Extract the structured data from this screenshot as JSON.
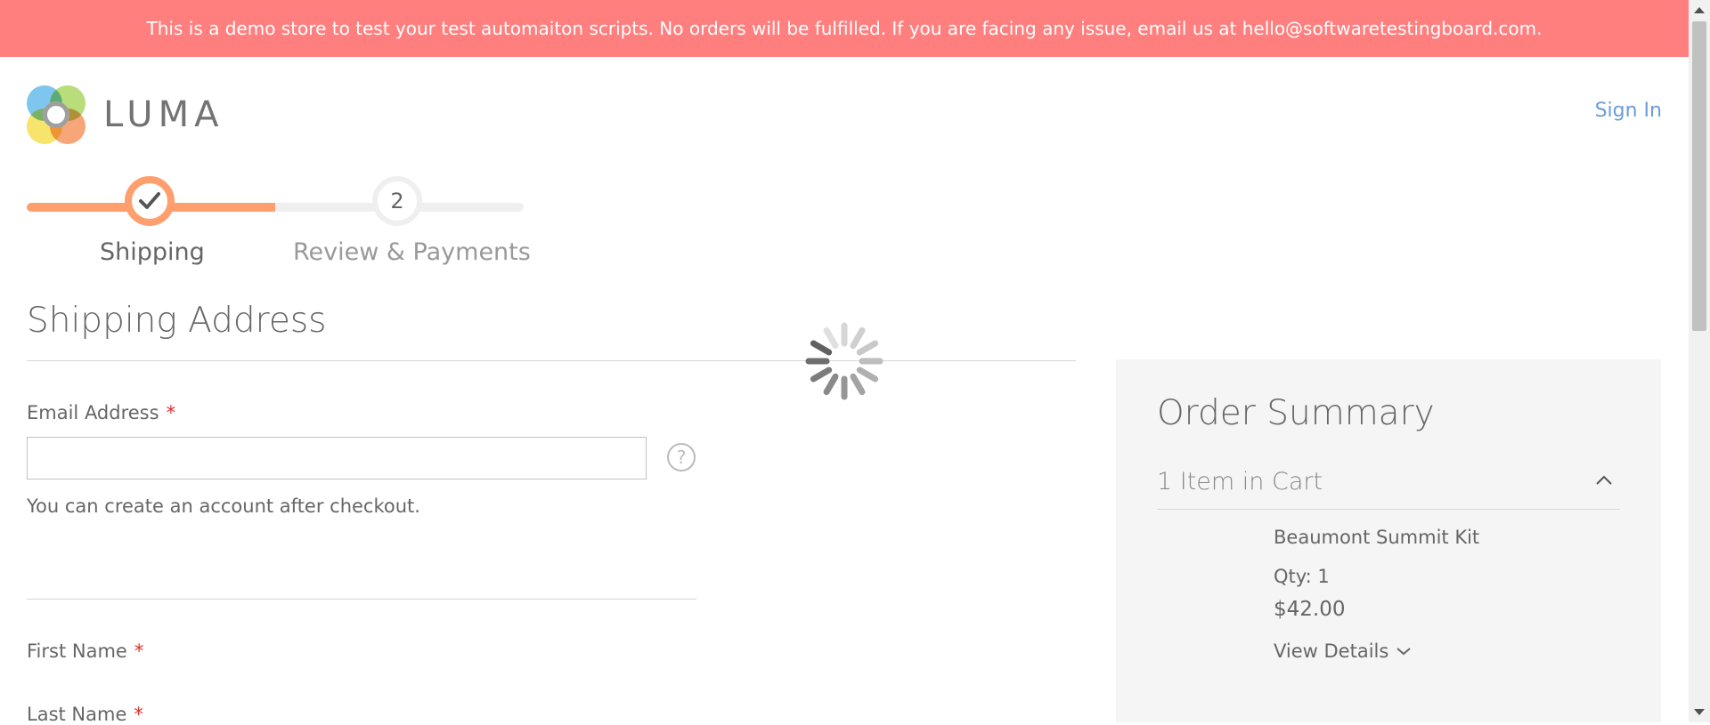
{
  "banner": {
    "text": "This is a demo store to test your test automaiton scripts. No orders will be fulfilled. If you are facing any issue, email us at hello@softwaretestingboard.com."
  },
  "header": {
    "logo_text": "LUMA",
    "sign_in": "Sign In"
  },
  "progress": {
    "steps": [
      {
        "number": "1",
        "label": "Shipping",
        "status": "complete"
      },
      {
        "number": "2",
        "label": "Review & Payments",
        "status": "pending"
      }
    ]
  },
  "shipping": {
    "title": "Shipping Address",
    "email_label": "Email Address",
    "email_value": "",
    "email_placeholder": "",
    "required_mark": "*",
    "help_glyph": "?",
    "account_note": "You can create an account after checkout.",
    "first_name_label": "First Name",
    "last_name_label": "Last Name"
  },
  "summary": {
    "title": "Order Summary",
    "cart_count": "1 Item in Cart",
    "item": {
      "name": "Beaumont Summit Kit",
      "qty": "Qty: 1",
      "price": "$42.00",
      "view_details": "View Details"
    }
  },
  "colors": {
    "banner_bg": "#ff7f7f",
    "progress_accent": "#ff9f6e",
    "link": "#6b9dd6",
    "required": "#e02b27"
  },
  "icons": [
    "check-icon",
    "help-icon",
    "chevron-up-icon",
    "chevron-down-icon",
    "loading-spinner-icon"
  ]
}
